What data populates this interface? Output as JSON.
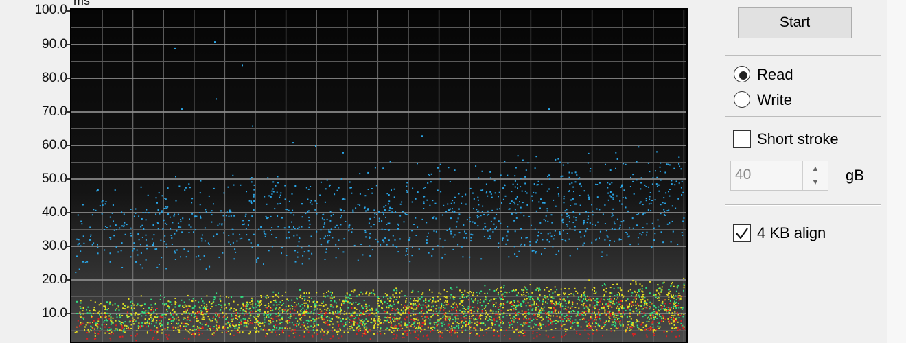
{
  "chart": {
    "unit": "ms",
    "y_ticks": [
      "100.0",
      "90.0",
      "80.0",
      "70.0",
      "60.0",
      "50.0",
      "40.0",
      "30.0",
      "20.0",
      "10.0"
    ]
  },
  "chart_data": {
    "type": "scatter",
    "ylabel": "ms",
    "ylim": [
      0,
      100
    ],
    "grid": true,
    "series": [
      {
        "color": "#2aa5e6",
        "band": [
          28,
          48
        ],
        "trend": [
          0.3,
          0.46
        ]
      },
      {
        "color": "#30e080",
        "band": [
          8,
          22
        ],
        "trend": [
          0.1,
          0.24
        ]
      },
      {
        "color": "#e8e020",
        "band": [
          6,
          22
        ],
        "trend": [
          0.08,
          0.27
        ]
      },
      {
        "color": "#e02020",
        "band": [
          4,
          18
        ],
        "trend": [
          0.05,
          0.24
        ]
      }
    ]
  },
  "controls": {
    "start_label": "Start",
    "read_label": "Read",
    "write_label": "Write",
    "read_selected": true,
    "short_stroke_label": "Short stroke",
    "short_stroke_checked": false,
    "stroke_value": "40",
    "unit_gb": "gB",
    "align_label": "4 KB align",
    "align_checked": true
  }
}
